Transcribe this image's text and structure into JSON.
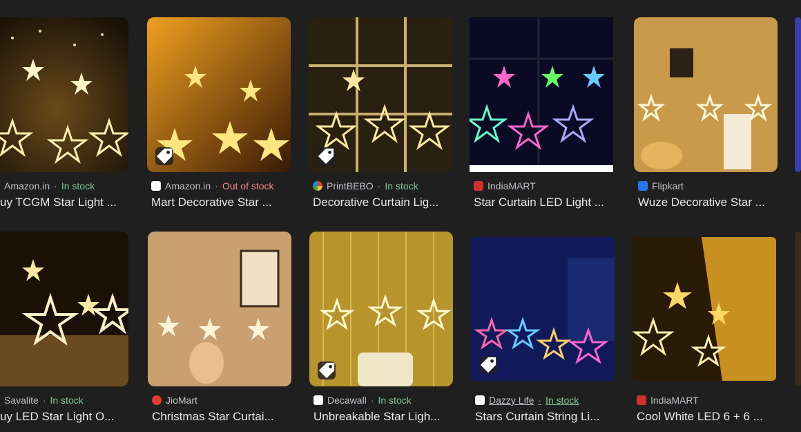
{
  "row1": [
    {
      "source": "Amazon.in",
      "stock": "In stock",
      "stock_status": "in",
      "title": "uy TCGM Star Light ...",
      "fav_color": "#ffffff"
    },
    {
      "source": "Amazon.in",
      "stock": "Out of stock",
      "stock_status": "out",
      "title": "Mart Decorative Star ...",
      "fav_color": "#ffffff"
    },
    {
      "source": "PrintBEBO",
      "stock": "In stock",
      "stock_status": "in",
      "title": "Decorative Curtain Lig...",
      "fav_color": "#e53935"
    },
    {
      "source": "IndiaMART",
      "stock": "",
      "stock_status": "",
      "title": "Star Curtain LED Light ...",
      "fav_color": "#d32f2f"
    },
    {
      "source": "Flipkart",
      "stock": "",
      "stock_status": "",
      "title": "Wuze Decorative Star ...",
      "fav_color": "#2874f0"
    }
  ],
  "row2": [
    {
      "source": "Savalite",
      "stock": "In stock",
      "stock_status": "in",
      "title": "uy LED Star Light O...",
      "fav_color": "#ffffff"
    },
    {
      "source": "JioMart",
      "stock": "",
      "stock_status": "",
      "title": "Christmas Star Curtai...",
      "fav_color": "#e53935"
    },
    {
      "source": "Decawall",
      "stock": "In stock",
      "stock_status": "in",
      "title": "Unbreakable Star Ligh...",
      "fav_color": "#ffffff"
    },
    {
      "source": "Dazzy Life",
      "stock": "In stock",
      "stock_status": "in",
      "title": "Stars Curtain String Li...",
      "fav_color": "#ffffff"
    },
    {
      "source": "IndiaMART",
      "stock": "",
      "stock_status": "",
      "title": "Cool White LED 6 + 6 ...",
      "fav_color": "#d32f2f"
    }
  ],
  "separator": "·",
  "icons": {
    "tag": "tag-icon"
  }
}
